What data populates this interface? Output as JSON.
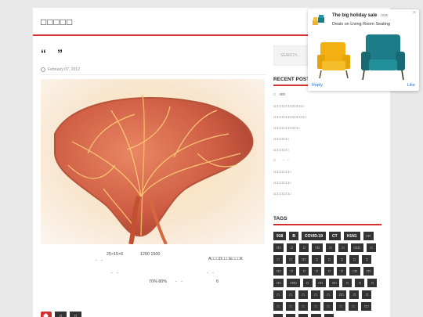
{
  "site": {
    "title": "□□□□□"
  },
  "post": {
    "title": "“　”",
    "date": "February 07, 2012",
    "body_lines": [
      "25×15×6　　　　1200  1500",
      "-　-",
      "A□□□D□□□E□□□K",
      "-　-",
      "-　-",
      "70%  80%　　-　-　　　　　　　　6"
    ],
    "tags": [
      "□",
      "□"
    ]
  },
  "sidebar": {
    "search_placeholder": "SEARCH...",
    "recent_title": "RECENT POSTS",
    "recent_posts": [
      "□　400",
      "□□□□□□□□□□□□□□",
      "□□□□□□□□□□□□□□□",
      "□□□□□□□□□□□□",
      "□□□□□□□",
      "□□□□□□□",
      "□　　-　-",
      "□□□□□□□□",
      "□□□□□□□□",
      "□□□□□□□□"
    ],
    "tags_title": "TAGS",
    "tag_cloud": [
      "918",
      "B",
      "COVID-19",
      "CT",
      "H1N1",
      "□□",
      "□□",
      "□",
      "□",
      "□□",
      "□",
      "□",
      "□□□",
      "□",
      "□",
      "□",
      "□□",
      "□",
      "□",
      "□",
      "□",
      "□",
      "□□",
      "□",
      "□",
      "□",
      "□",
      "□",
      "□□",
      "□□",
      "□□",
      "□□□",
      "□",
      "□□",
      "□□",
      "□",
      "□",
      "□",
      "□",
      "□",
      "□",
      "□",
      "□",
      "□□",
      "□",
      "□",
      "□",
      "□",
      "□",
      "□",
      "□",
      "□",
      "□",
      "□□",
      "□",
      "□",
      "□",
      "□□",
      "□"
    ]
  },
  "notification": {
    "title": "The big holiday sale",
    "time": "· now",
    "subtitle": "Deals on Living Room Seating",
    "reply": "Reply",
    "like": "Like",
    "close": "×"
  }
}
